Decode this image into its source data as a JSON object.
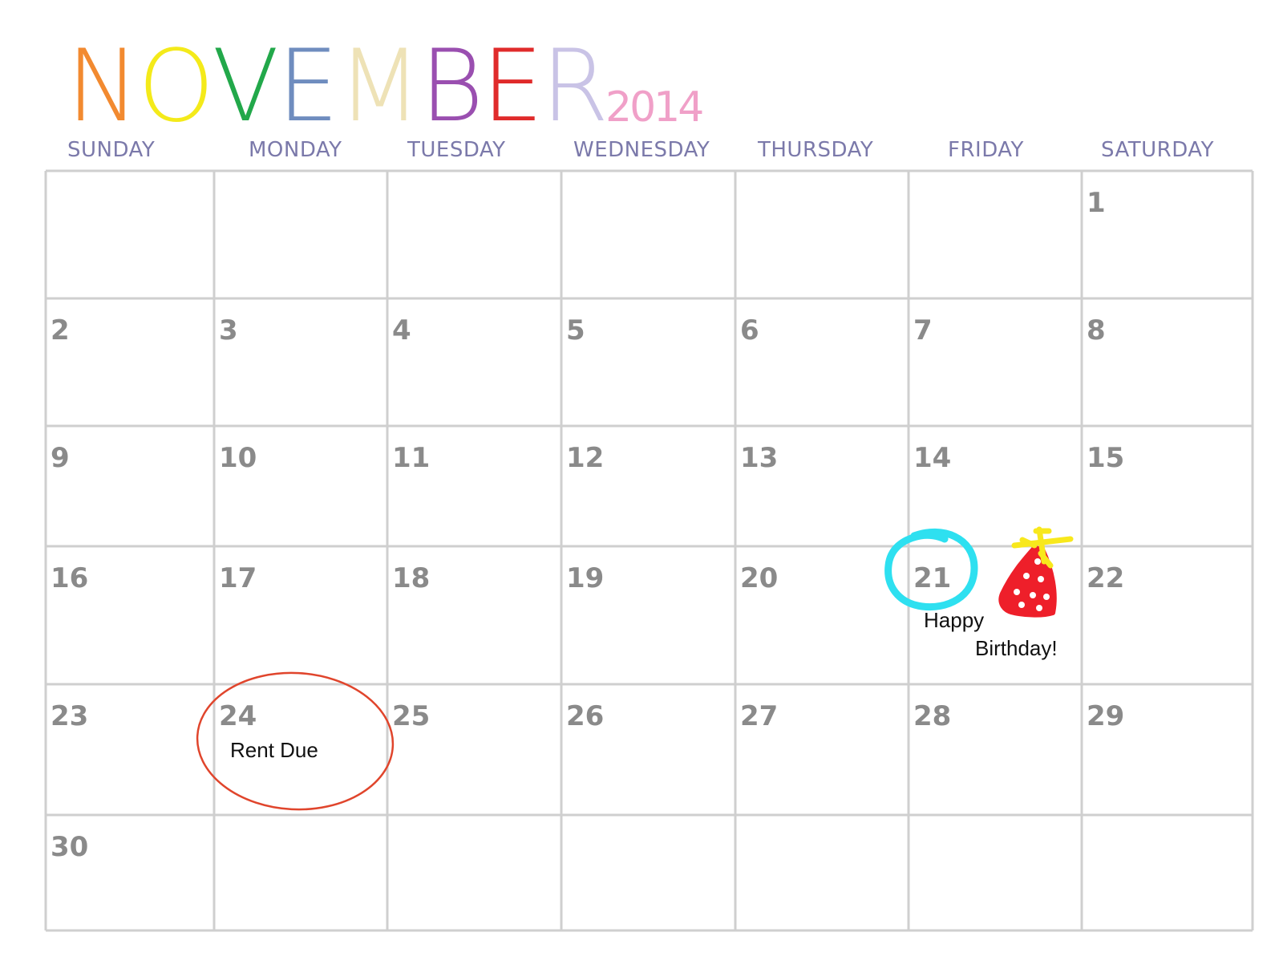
{
  "calendar": {
    "month_letters": [
      {
        "char": "N",
        "color": "#f28a30"
      },
      {
        "char": "O",
        "color": "#f4ea1a"
      },
      {
        "char": "V",
        "color": "#22a84a"
      },
      {
        "char": "E",
        "color": "#6f8dbf"
      },
      {
        "char": "M",
        "color": "#eee2b6"
      },
      {
        "char": "B",
        "color": "#9a4fb0"
      },
      {
        "char": "E",
        "color": "#e02b2b"
      },
      {
        "char": "R",
        "color": "#c9c3e6"
      }
    ],
    "year": "2014",
    "year_color": "#f0a0c8",
    "weekdays": [
      "SUNDAY",
      "MONDAY",
      "TUESDAY",
      "WEDNESDAY",
      "THURSDAY",
      "FRIDAY",
      "SATURDAY"
    ],
    "weeks": [
      [
        "",
        "",
        "",
        "",
        "",
        "",
        "1"
      ],
      [
        "2",
        "3",
        "4",
        "5",
        "6",
        "7",
        "8"
      ],
      [
        "9",
        "10",
        "11",
        "12",
        "13",
        "14",
        "15"
      ],
      [
        "16",
        "17",
        "18",
        "19",
        "20",
        "21",
        "22"
      ],
      [
        "23",
        "24",
        "25",
        "26",
        "27",
        "28",
        "29"
      ],
      [
        "30",
        "",
        "",
        "",
        "",
        "",
        ""
      ]
    ]
  },
  "annotations": {
    "rent_due": "Rent Due",
    "happy": "Happy",
    "birthday": "Birthday!",
    "rent_circle_color": "#e0452c",
    "birthday_circle_color": "#2ee0f0",
    "hat_color": "#ee1f2a",
    "hat_pompom_color": "#f8e81c"
  }
}
